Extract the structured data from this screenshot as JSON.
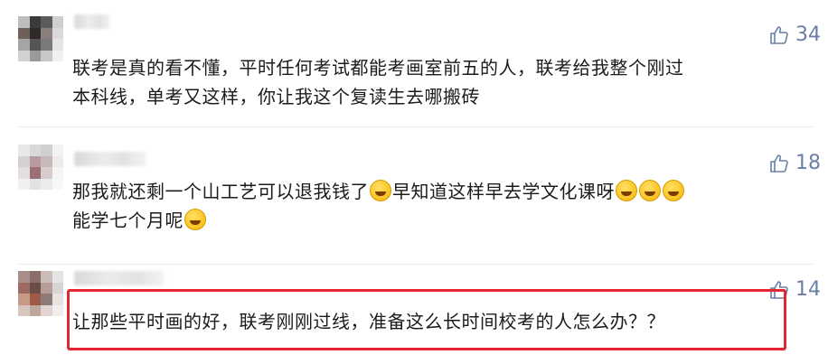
{
  "comments": [
    {
      "likes": "34",
      "lines": [
        "联考是真的看不懂，平时任何考试都能考画室前五的人，联考给我整个刚过",
        "本科线，单考又这样，你让我这个复读生去哪搬砖"
      ]
    },
    {
      "likes": "18",
      "line1_a": "那我就还剩一个山工艺可以退我钱了",
      "line1_b": "早知道这样早去学文化课呀",
      "line2": "能学七个月呢"
    },
    {
      "likes": "14",
      "lines": [
        "让那些平时画的好，联考刚刚过线，准备这么长时间校考的人怎么办？？"
      ]
    }
  ],
  "icons": {
    "like": "thumbs-up-icon",
    "emoji": "laughing-face-emoji"
  },
  "colors": {
    "like": "#6b7fa6",
    "highlight": "#e3262f"
  }
}
